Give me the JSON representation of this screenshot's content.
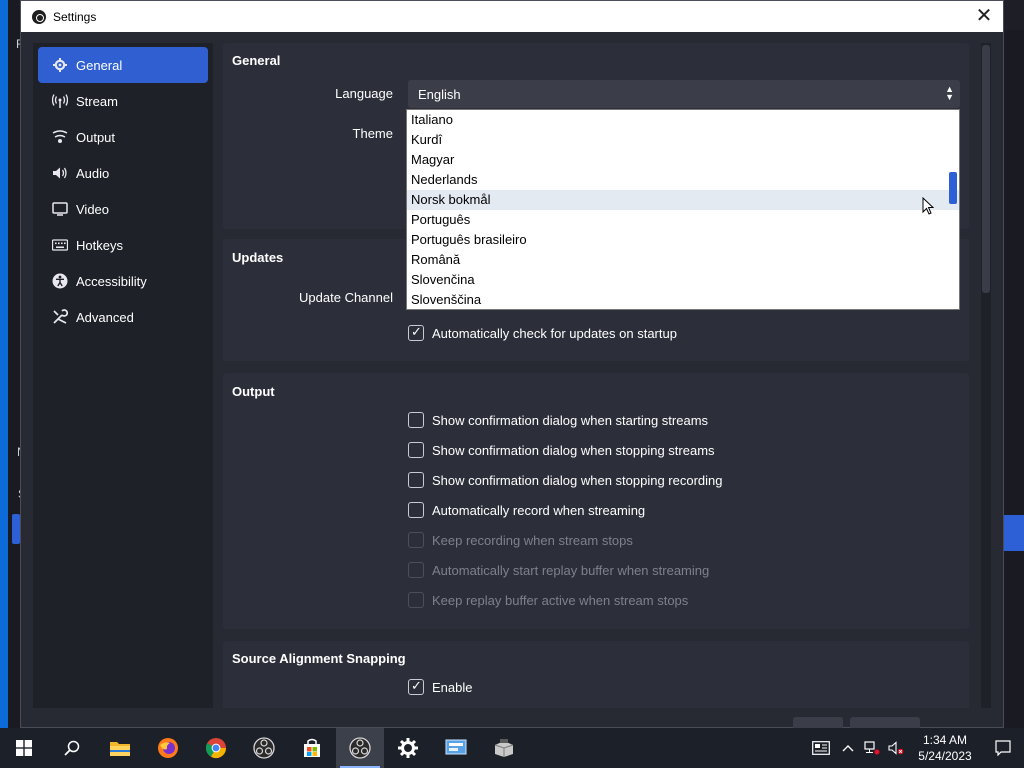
{
  "window": {
    "title": "Settings",
    "close_label": "✕"
  },
  "background": {
    "left_letter_1": "F",
    "left_letter_2": "N",
    "left_letter_3": "S"
  },
  "sidebar": {
    "items": [
      {
        "label": "General",
        "icon": "gear-icon",
        "active": true
      },
      {
        "label": "Stream",
        "icon": "antenna-icon"
      },
      {
        "label": "Output",
        "icon": "output-icon"
      },
      {
        "label": "Audio",
        "icon": "speaker-icon"
      },
      {
        "label": "Video",
        "icon": "monitor-icon"
      },
      {
        "label": "Hotkeys",
        "icon": "keyboard-icon"
      },
      {
        "label": "Accessibility",
        "icon": "accessibility-icon"
      },
      {
        "label": "Advanced",
        "icon": "tools-icon"
      }
    ]
  },
  "general": {
    "title": "General",
    "language_label": "Language",
    "language_value": "English",
    "theme_label": "Theme"
  },
  "language_dropdown": {
    "options": [
      "Italiano",
      "Kurdî",
      "Magyar",
      "Nederlands",
      "Norsk bokmål",
      "Português",
      "Português brasileiro",
      "Română",
      "Slovenčina",
      "Slovenščina"
    ],
    "highlighted": "Norsk bokmål"
  },
  "updates": {
    "title": "Updates",
    "channel_label": "Update Channel",
    "auto_check_label": "Automatically check for updates on startup"
  },
  "output": {
    "title": "Output",
    "options": [
      {
        "label": "Show confirmation dialog when starting streams",
        "checked": false,
        "enabled": true
      },
      {
        "label": "Show confirmation dialog when stopping streams",
        "checked": false,
        "enabled": true
      },
      {
        "label": "Show confirmation dialog when stopping recording",
        "checked": false,
        "enabled": true
      },
      {
        "label": "Automatically record when streaming",
        "checked": false,
        "enabled": true
      },
      {
        "label": "Keep recording when stream stops",
        "checked": false,
        "enabled": false
      },
      {
        "label": "Automatically start replay buffer when streaming",
        "checked": false,
        "enabled": false
      },
      {
        "label": "Keep replay buffer active when stream stops",
        "checked": false,
        "enabled": false
      }
    ]
  },
  "snapping": {
    "title": "Source Alignment Snapping",
    "enable_label": "Enable"
  },
  "taskbar": {
    "time": "1:34 AM",
    "date": "5/24/2023",
    "apps": [
      "windows-start-icon",
      "search-icon",
      "file-explorer-icon",
      "firefox-icon",
      "chrome-icon",
      "obs-icon",
      "store-icon",
      "obs-active-icon",
      "settings-gear-icon",
      "control-panel-icon",
      "installer-icon"
    ]
  },
  "colors": {
    "accent": "#2f5fd0",
    "panel_bg": "#272a33",
    "group_bg": "#2c2f39"
  }
}
